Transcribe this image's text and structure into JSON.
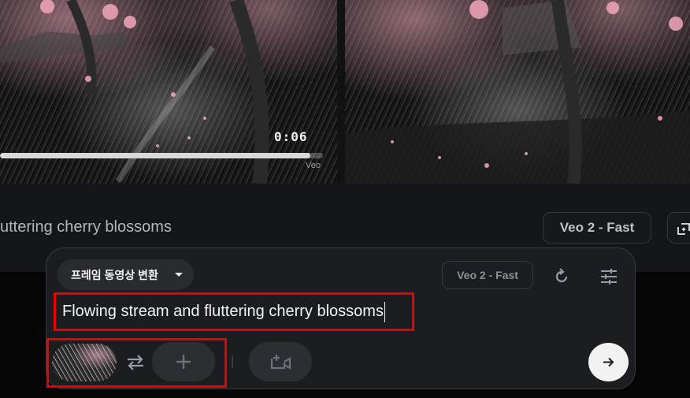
{
  "videos": [
    {
      "time": "0:06",
      "watermark": "Veo",
      "progress": 0.96
    },
    {
      "state": "paused"
    }
  ],
  "caption": "uttering cherry blossoms",
  "model_button": "Veo 2 - Fast",
  "composer": {
    "mode": "프레임 동영상 변환",
    "model_chip": "Veo 2 - Fast",
    "prompt": "Flowing stream and fluttering cherry blossoms"
  },
  "icons": {
    "extend": "sparkle-crop-icon",
    "reset": "rotate-icon",
    "settings": "sliders-icon",
    "swap": "swap-arrows-icon",
    "add": "plus-icon",
    "camera": "camera-plus-icon",
    "send": "arrow-right-icon"
  },
  "colors": {
    "highlight": "#e00000",
    "background": "#111214"
  }
}
